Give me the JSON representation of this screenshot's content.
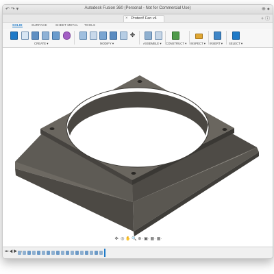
{
  "window": {
    "title": "Autodesk Fusion 360 (Personal - Not for Commercial Use)",
    "document_tab": "Protect! Fan v4"
  },
  "workspace_tabs": [
    "SOLID",
    "SURFACE",
    "SHEET METAL",
    "TOOLS"
  ],
  "toolbar_groups": {
    "create": "CREATE ▾",
    "modify": "MODIFY ▾",
    "assemble": "ASSEMBLE ▾",
    "construct": "CONSTRUCT ▾",
    "inspect": "INSPECT ▾",
    "insert": "INSERT ▾",
    "select": "SELECT ▾"
  },
  "colors": {
    "accent": "#1e7ac8",
    "model_dark": "#3d3b37",
    "model_mid": "#5b5852",
    "model_light": "#7b7770"
  },
  "icons": {
    "undo": "undo-icon",
    "redo": "redo-icon",
    "save": "save-icon",
    "close": "close-icon",
    "orbit": "orbit-icon",
    "pan": "pan-icon",
    "zoom": "zoom-icon",
    "display": "display-settings-icon",
    "grid": "grid-icon"
  },
  "timeline": {
    "controls": "⏮◀▶⏭"
  }
}
